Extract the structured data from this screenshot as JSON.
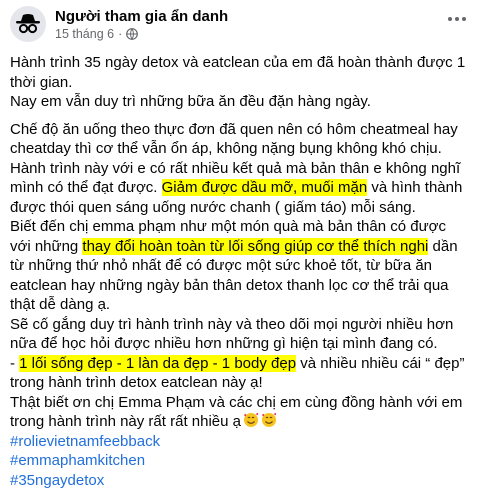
{
  "author": {
    "name": "Người tham gia ẩn danh",
    "date": "15 tháng 6",
    "separator": "·",
    "avatar_icon": "anonymous-spy-icon",
    "privacy_icon": "globe-icon"
  },
  "menu_icon": "more-options-icon",
  "post": {
    "p1a": "Hành trình 35 ngày detox và eatclean của em đã hoàn thành được 1 thời gian.",
    "p1b": "Nay em vẫn duy trì những bữa ăn đều đặn hàng ngày.",
    "p2_t1": "Chế độ ăn uống theo thực đơn đã quen nên có hôm cheatmeal hay cheatday thì cơ thể vẫn ổn áp, không nặng bụng không khó chịu. Hành trình này với e có rất nhiều kết quả mà bản thân e không nghĩ mình có thể đạt được. ",
    "p2_h1": "Giảm được dầu mỡ, muối mặn",
    "p2_t2": " và hình thành được thói quen sáng uống nước chanh ( giấm táo) mỗi sáng.",
    "p3_t1": "Biết đến chị emma phạm như một món quà mà bản thân có được với những ",
    "p3_h1": "thay đổi hoàn toàn từ lối sống giúp cơ thể thích nghi",
    "p3_t2": " dần từ những thứ nhỏ nhất để có được một sức khoẻ tốt, từ bữa ăn eatclean hay những ngày bản thân detox thanh lọc cơ thể trải qua thật dễ dàng ạ.",
    "p4": "Sẽ cố gắng duy trì hành trình này và theo dõi mọi người nhiều hơn nữa để học hỏi được nhiều hơn những gì hiện tại mình đang có.",
    "p5_t1": "- ",
    "p5_h1": "1 lối sống đẹp - 1 làn da đẹp - 1 body đẹp",
    "p5_t2": " và nhiều nhiều cái “ đẹp” trong hành trình detox eatclean này ạ!",
    "p6": "Thật biết ơn chị Emma Phạm và các chị em cùng đồng hành với em trong hành trình này rất rất nhiều ạ",
    "p6_emoji": "smiling-face-with-hearts-icon"
  },
  "hashtags": [
    "#rolievietnamfeebback",
    "#emmaphamkitchen",
    "#35ngaydetox"
  ],
  "colors": {
    "highlight": "#ffff00",
    "hashtag": "#216fdb",
    "meta": "#65676b"
  }
}
